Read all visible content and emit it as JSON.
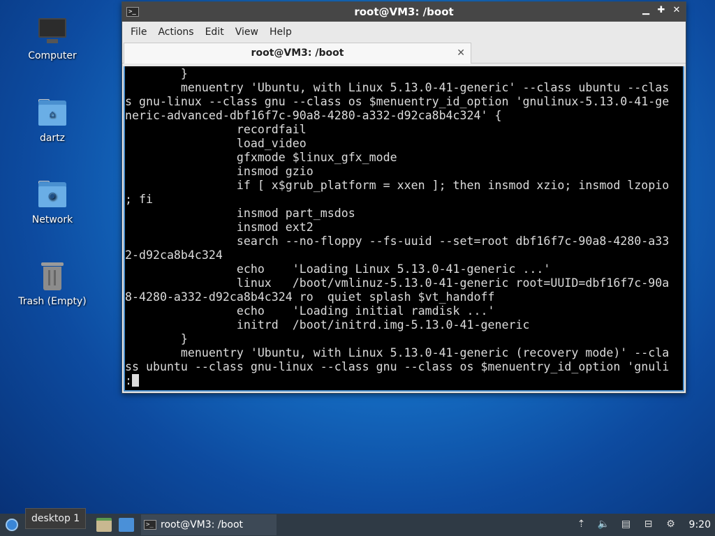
{
  "desktop": {
    "icons": [
      {
        "label": "Computer"
      },
      {
        "label": "dartz"
      },
      {
        "label": "Network"
      },
      {
        "label": "Trash (Empty)"
      }
    ]
  },
  "window": {
    "title": "root@VM3: /boot",
    "menu": [
      "File",
      "Actions",
      "Edit",
      "View",
      "Help"
    ],
    "tab_label": "root@VM3: /boot",
    "terminal_lines": [
      "        }",
      "        menuentry 'Ubuntu, with Linux 5.13.0-41-generic' --class ubuntu --clas",
      "s gnu-linux --class gnu --class os $menuentry_id_option 'gnulinux-5.13.0-41-ge",
      "neric-advanced-dbf16f7c-90a8-4280-a332-d92ca8b4c324' {",
      "                recordfail",
      "                load_video",
      "                gfxmode $linux_gfx_mode",
      "                insmod gzio",
      "                if [ x$grub_platform = xxen ]; then insmod xzio; insmod lzopio",
      "; fi",
      "                insmod part_msdos",
      "                insmod ext2",
      "                search --no-floppy --fs-uuid --set=root dbf16f7c-90a8-4280-a33",
      "2-d92ca8b4c324",
      "                echo    'Loading Linux 5.13.0-41-generic ...'",
      "                linux   /boot/vmlinuz-5.13.0-41-generic root=UUID=dbf16f7c-90a",
      "8-4280-a332-d92ca8b4c324 ro  quiet splash $vt_handoff",
      "                echo    'Loading initial ramdisk ...'",
      "                initrd  /boot/initrd.img-5.13.0-41-generic",
      "        }",
      "        menuentry 'Ubuntu, with Linux 5.13.0-41-generic (recovery mode)' --cla",
      "ss ubuntu --class gnu-linux --class gnu --class os $menuentry_id_option 'gnuli"
    ],
    "prompt": ":"
  },
  "taskbar": {
    "pager_tooltip": "desktop 1",
    "task_label": "root@VM3: /boot",
    "clock": "9:20"
  }
}
